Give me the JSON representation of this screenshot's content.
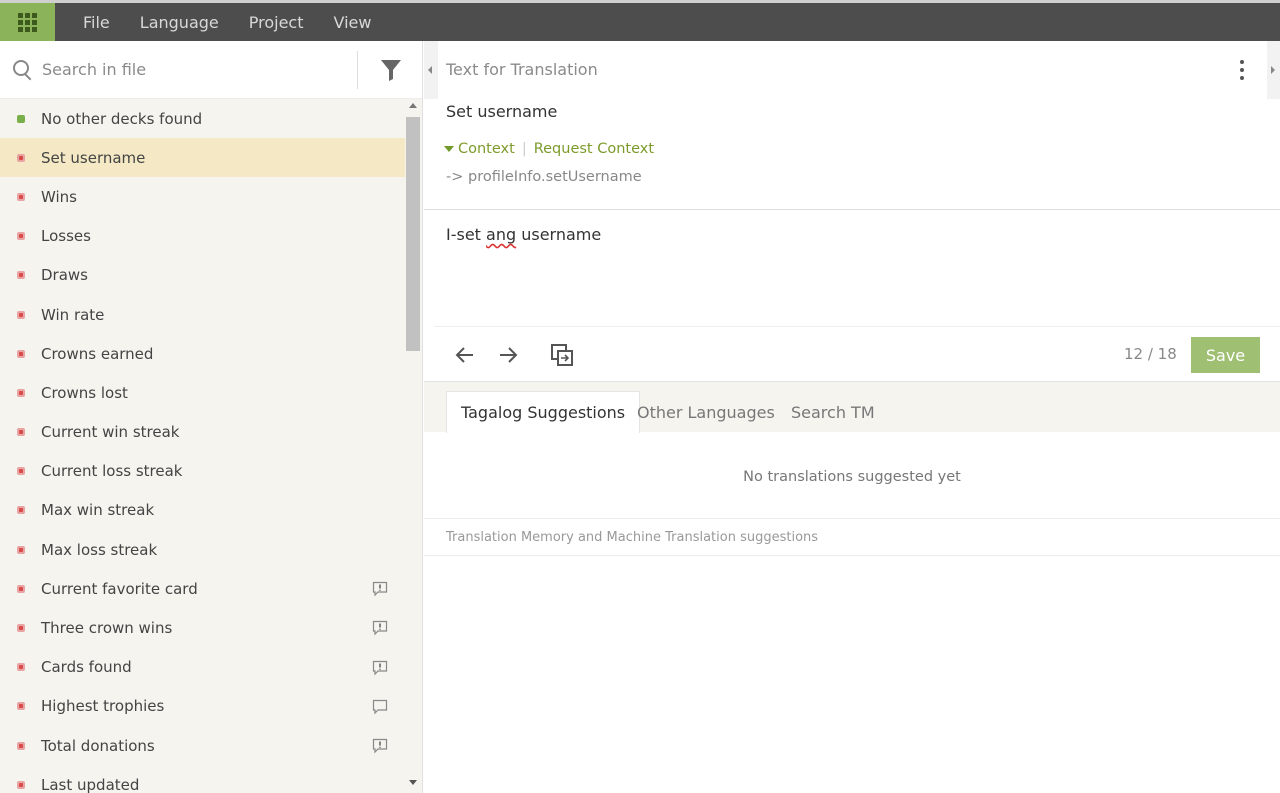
{
  "menu": {
    "items": [
      "File",
      "Language",
      "Project",
      "View"
    ]
  },
  "search": {
    "placeholder": "Search in file"
  },
  "strings": [
    {
      "label": "No other decks found",
      "status": "translated",
      "comment": "none"
    },
    {
      "label": "Set username",
      "status": "untranslated",
      "comment": "none",
      "selected": true
    },
    {
      "label": "Wins",
      "status": "untranslated",
      "comment": "none"
    },
    {
      "label": "Losses",
      "status": "untranslated",
      "comment": "none"
    },
    {
      "label": "Draws",
      "status": "untranslated",
      "comment": "none"
    },
    {
      "label": "Win rate",
      "status": "untranslated",
      "comment": "none"
    },
    {
      "label": "Crowns earned",
      "status": "untranslated",
      "comment": "none"
    },
    {
      "label": "Crowns lost",
      "status": "untranslated",
      "comment": "none"
    },
    {
      "label": "Current win streak",
      "status": "untranslated",
      "comment": "none"
    },
    {
      "label": "Current loss streak",
      "status": "untranslated",
      "comment": "none"
    },
    {
      "label": "Max win streak",
      "status": "untranslated",
      "comment": "none"
    },
    {
      "label": "Max loss streak",
      "status": "untranslated",
      "comment": "none"
    },
    {
      "label": "Current favorite card",
      "status": "untranslated",
      "comment": "issue"
    },
    {
      "label": "Three crown wins",
      "status": "untranslated",
      "comment": "issue"
    },
    {
      "label": "Cards found",
      "status": "untranslated",
      "comment": "issue"
    },
    {
      "label": "Highest trophies",
      "status": "untranslated",
      "comment": "comment"
    },
    {
      "label": "Total donations",
      "status": "untranslated",
      "comment": "issue"
    },
    {
      "label": "Last updated",
      "status": "untranslated",
      "comment": "none"
    }
  ],
  "editor": {
    "header_label": "Text for Translation",
    "source_text": "Set username",
    "context_label": "Context",
    "request_context_label": "Request Context",
    "context_key": "-> profileInfo.setUsername",
    "translation_prefix": "I-set ",
    "translation_misspelled": "ang",
    "translation_suffix": " username",
    "counter": "12 / 18",
    "save_label": "Save"
  },
  "suggestions": {
    "tabs": [
      "Tagalog Suggestions",
      "Other Languages",
      "Search TM"
    ],
    "active_tab": 0,
    "empty_text": "No translations suggested yet",
    "tm_label": "Translation Memory and Machine Translation suggestions"
  },
  "colors": {
    "accent": "#8bb35a",
    "link": "#7d9b2c",
    "untranslated": "#d94b4b",
    "translated": "#7ab04a",
    "selected_row": "#f4e9c4"
  }
}
